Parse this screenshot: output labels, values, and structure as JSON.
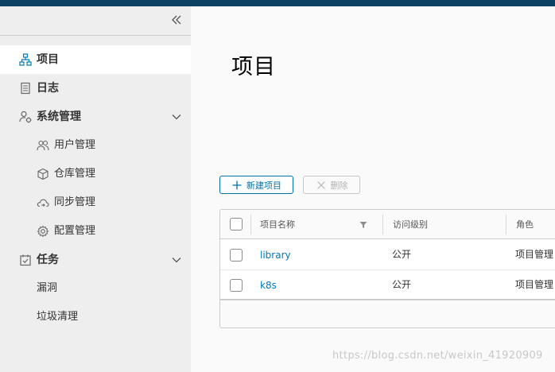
{
  "sidebar": {
    "collapse_icon": "double-chevron-left-icon",
    "items": [
      {
        "label": "项目",
        "icon": "projects-icon",
        "active": true
      },
      {
        "label": "日志",
        "icon": "logs-icon"
      },
      {
        "label": "系统管理",
        "icon": "user-admin-icon",
        "expanded": true,
        "children": [
          {
            "label": "用户管理",
            "icon": "users-icon"
          },
          {
            "label": "仓库管理",
            "icon": "box-icon"
          },
          {
            "label": "同步管理",
            "icon": "cloud-sync-icon"
          },
          {
            "label": "配置管理",
            "icon": "gear-icon"
          }
        ]
      },
      {
        "label": "任务",
        "icon": "tasks-icon",
        "expanded": true,
        "children": [
          {
            "label": "漏洞"
          },
          {
            "label": "垃圾清理"
          }
        ]
      }
    ]
  },
  "main": {
    "title": "项目",
    "actions": {
      "new_label": "新建项目",
      "delete_label": "删除"
    },
    "table": {
      "columns": [
        "项目名称",
        "访问级别",
        "角色"
      ],
      "rows": [
        {
          "name": "library",
          "access": "公开",
          "role": "项目管理"
        },
        {
          "name": "k8s",
          "access": "公开",
          "role": "项目管理"
        }
      ]
    }
  },
  "watermark": "https://blog.csdn.net/weixin_41920909",
  "colors": {
    "topbar": "#0d4163",
    "accent": "#0079b8",
    "sidebar_bg": "#eeeeee"
  }
}
